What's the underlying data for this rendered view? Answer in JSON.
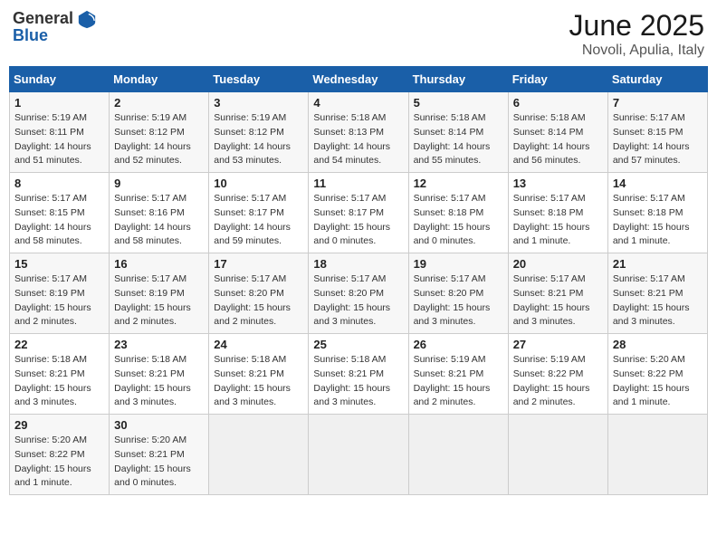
{
  "header": {
    "logo_general": "General",
    "logo_blue": "Blue",
    "month": "June 2025",
    "location": "Novoli, Apulia, Italy"
  },
  "weekdays": [
    "Sunday",
    "Monday",
    "Tuesday",
    "Wednesday",
    "Thursday",
    "Friday",
    "Saturday"
  ],
  "weeks": [
    [
      {
        "day": "1",
        "sunrise": "5:19 AM",
        "sunset": "8:11 PM",
        "daylight": "14 hours and 51 minutes."
      },
      {
        "day": "2",
        "sunrise": "5:19 AM",
        "sunset": "8:12 PM",
        "daylight": "14 hours and 52 minutes."
      },
      {
        "day": "3",
        "sunrise": "5:19 AM",
        "sunset": "8:12 PM",
        "daylight": "14 hours and 53 minutes."
      },
      {
        "day": "4",
        "sunrise": "5:18 AM",
        "sunset": "8:13 PM",
        "daylight": "14 hours and 54 minutes."
      },
      {
        "day": "5",
        "sunrise": "5:18 AM",
        "sunset": "8:14 PM",
        "daylight": "14 hours and 55 minutes."
      },
      {
        "day": "6",
        "sunrise": "5:18 AM",
        "sunset": "8:14 PM",
        "daylight": "14 hours and 56 minutes."
      },
      {
        "day": "7",
        "sunrise": "5:17 AM",
        "sunset": "8:15 PM",
        "daylight": "14 hours and 57 minutes."
      }
    ],
    [
      {
        "day": "8",
        "sunrise": "5:17 AM",
        "sunset": "8:15 PM",
        "daylight": "14 hours and 58 minutes."
      },
      {
        "day": "9",
        "sunrise": "5:17 AM",
        "sunset": "8:16 PM",
        "daylight": "14 hours and 58 minutes."
      },
      {
        "day": "10",
        "sunrise": "5:17 AM",
        "sunset": "8:17 PM",
        "daylight": "14 hours and 59 minutes."
      },
      {
        "day": "11",
        "sunrise": "5:17 AM",
        "sunset": "8:17 PM",
        "daylight": "15 hours and 0 minutes."
      },
      {
        "day": "12",
        "sunrise": "5:17 AM",
        "sunset": "8:18 PM",
        "daylight": "15 hours and 0 minutes."
      },
      {
        "day": "13",
        "sunrise": "5:17 AM",
        "sunset": "8:18 PM",
        "daylight": "15 hours and 1 minute."
      },
      {
        "day": "14",
        "sunrise": "5:17 AM",
        "sunset": "8:18 PM",
        "daylight": "15 hours and 1 minute."
      }
    ],
    [
      {
        "day": "15",
        "sunrise": "5:17 AM",
        "sunset": "8:19 PM",
        "daylight": "15 hours and 2 minutes."
      },
      {
        "day": "16",
        "sunrise": "5:17 AM",
        "sunset": "8:19 PM",
        "daylight": "15 hours and 2 minutes."
      },
      {
        "day": "17",
        "sunrise": "5:17 AM",
        "sunset": "8:20 PM",
        "daylight": "15 hours and 2 minutes."
      },
      {
        "day": "18",
        "sunrise": "5:17 AM",
        "sunset": "8:20 PM",
        "daylight": "15 hours and 3 minutes."
      },
      {
        "day": "19",
        "sunrise": "5:17 AM",
        "sunset": "8:20 PM",
        "daylight": "15 hours and 3 minutes."
      },
      {
        "day": "20",
        "sunrise": "5:17 AM",
        "sunset": "8:21 PM",
        "daylight": "15 hours and 3 minutes."
      },
      {
        "day": "21",
        "sunrise": "5:17 AM",
        "sunset": "8:21 PM",
        "daylight": "15 hours and 3 minutes."
      }
    ],
    [
      {
        "day": "22",
        "sunrise": "5:18 AM",
        "sunset": "8:21 PM",
        "daylight": "15 hours and 3 minutes."
      },
      {
        "day": "23",
        "sunrise": "5:18 AM",
        "sunset": "8:21 PM",
        "daylight": "15 hours and 3 minutes."
      },
      {
        "day": "24",
        "sunrise": "5:18 AM",
        "sunset": "8:21 PM",
        "daylight": "15 hours and 3 minutes."
      },
      {
        "day": "25",
        "sunrise": "5:18 AM",
        "sunset": "8:21 PM",
        "daylight": "15 hours and 3 minutes."
      },
      {
        "day": "26",
        "sunrise": "5:19 AM",
        "sunset": "8:21 PM",
        "daylight": "15 hours and 2 minutes."
      },
      {
        "day": "27",
        "sunrise": "5:19 AM",
        "sunset": "8:22 PM",
        "daylight": "15 hours and 2 minutes."
      },
      {
        "day": "28",
        "sunrise": "5:20 AM",
        "sunset": "8:22 PM",
        "daylight": "15 hours and 1 minute."
      }
    ],
    [
      {
        "day": "29",
        "sunrise": "5:20 AM",
        "sunset": "8:22 PM",
        "daylight": "15 hours and 1 minute."
      },
      {
        "day": "30",
        "sunrise": "5:20 AM",
        "sunset": "8:21 PM",
        "daylight": "15 hours and 0 minutes."
      },
      null,
      null,
      null,
      null,
      null
    ]
  ]
}
